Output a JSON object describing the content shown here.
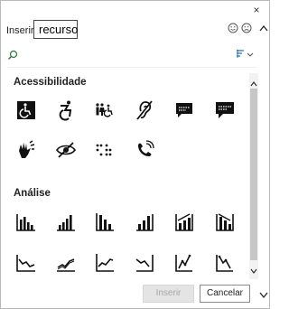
{
  "window": {
    "close_glyph": "×"
  },
  "search": {
    "label": "Inserir",
    "value": "recurso"
  },
  "sections": [
    {
      "title": "Acessibilidade",
      "icons": [
        "wheelchair-icon",
        "active-wheelchair-icon",
        "family-wheelchair-icon",
        "hearing-impaired-icon",
        "closed-captioning-icon",
        "speech-bubble-text-icon",
        "sign-language-icon",
        "visually-impaired-icon",
        "braille-icon",
        "hearing-phone-icon"
      ]
    },
    {
      "title": "Análise",
      "icons": [
        "bar-chart-rising-icon",
        "bar-chart-ascending-icon",
        "bar-chart-descending-icon",
        "bar-chart-boxed-icon",
        "bar-chart-trend-up-icon",
        "bar-chart-trend-down-icon",
        "line-chart-down-icon",
        "line-chart-up-icon",
        "line-chart-rising-icon",
        "line-chart-falling-icon",
        "line-chart-peak-icon",
        "line-chart-decline-icon"
      ]
    }
  ],
  "buttons": {
    "insert": "Inserir",
    "cancel": "Cancelar"
  },
  "colors": {
    "icon": "#111111",
    "disabled_text": "#a7a7a7"
  }
}
